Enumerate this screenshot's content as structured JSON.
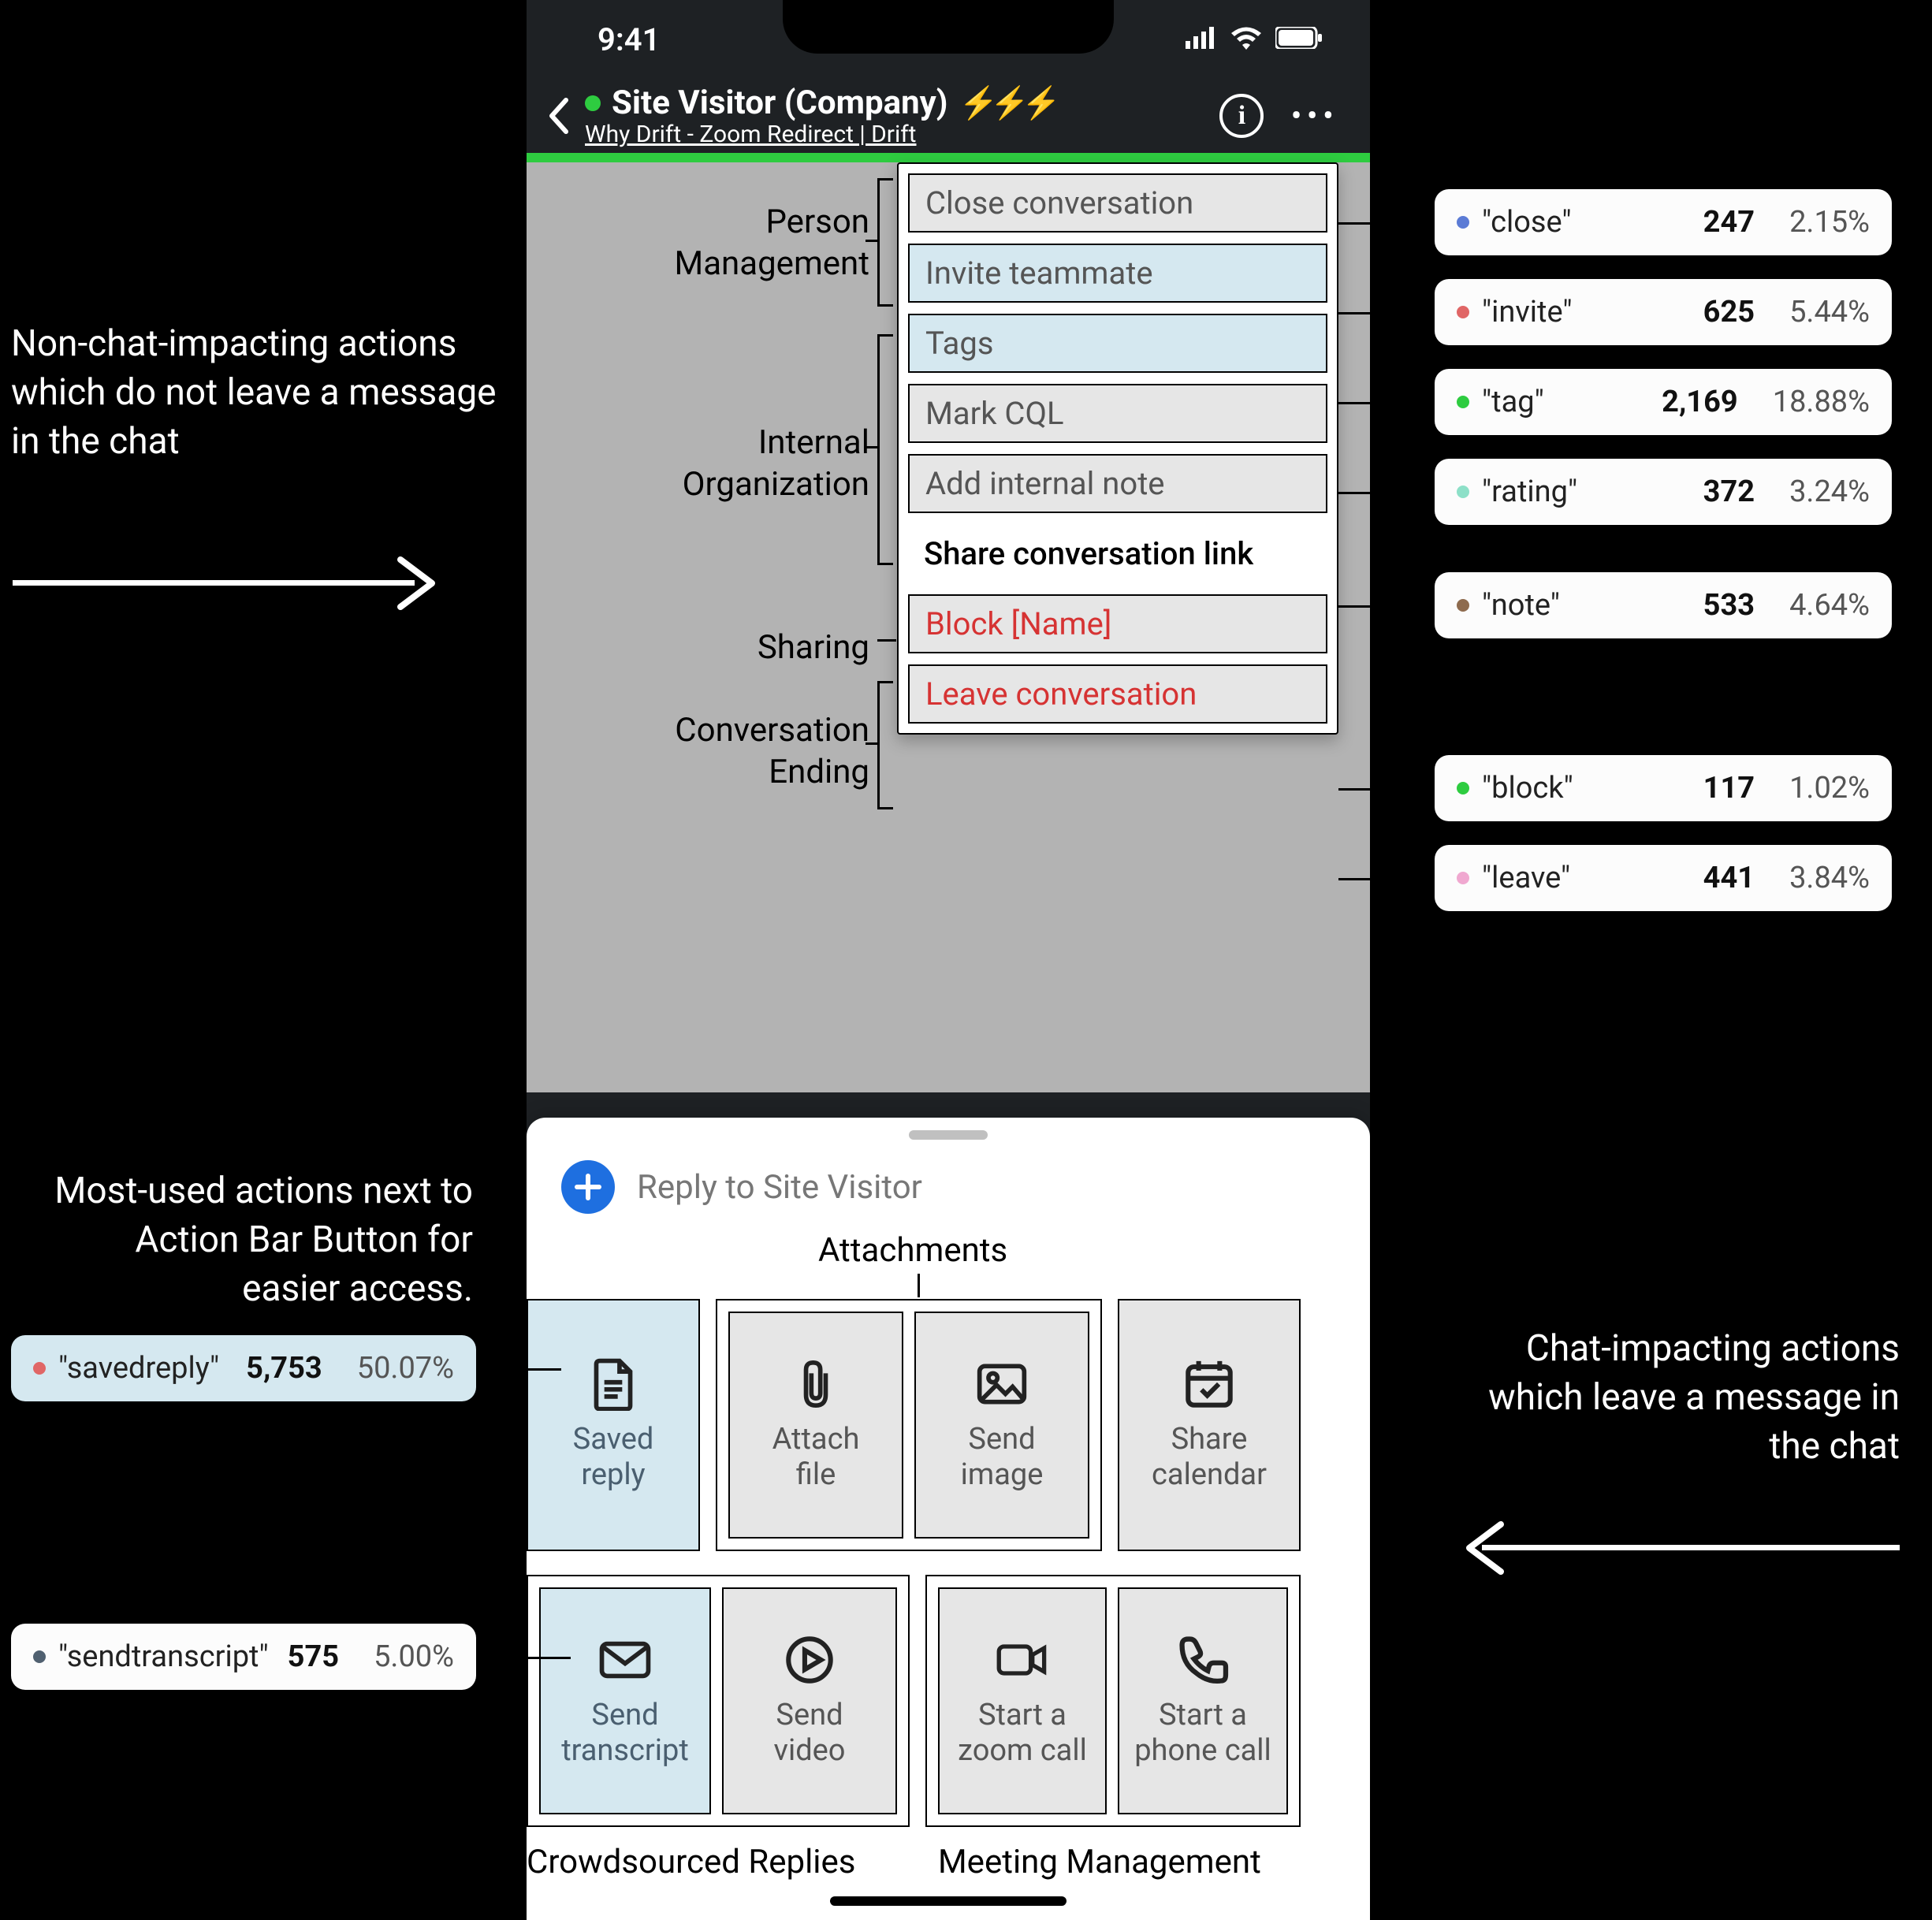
{
  "statusbar": {
    "time": "9:41"
  },
  "header": {
    "title": "Site Visitor (Company)",
    "subtitle": "Why Drift - Zoom Redirect | Drift"
  },
  "categories": {
    "person": "Person\nManagement",
    "internal": "Internal\nOrganization",
    "sharing": "Sharing",
    "ending": "Conversation\nEnding"
  },
  "dropdown": {
    "close": "Close conversation",
    "invite": "Invite teammate",
    "tags": "Tags",
    "markcql": "Mark CQL",
    "addnote": "Add internal note",
    "share": "Share conversation link",
    "block": "Block [Name]",
    "leave": "Leave conversation"
  },
  "reply": {
    "placeholder": "Reply to Site Visitor"
  },
  "tiles": {
    "savedreply": "Saved\nreply",
    "attachfile": "Attach\nfile",
    "sendimage": "Send\nimage",
    "calendar": "Share\ncalendar",
    "transcript": "Send\ntranscript",
    "video": "Send\nvideo",
    "zoom": "Start a\nzoom call",
    "phone": "Start a\nphone call"
  },
  "subcaps": {
    "attachments": "Attachments",
    "crowd": "Crowdsourced Replies",
    "meeting": "Meeting Management"
  },
  "stats": {
    "close": {
      "name": "\"close\"",
      "num": "247",
      "pct": "2.15%",
      "color": "#5b7bd5"
    },
    "invite": {
      "name": "\"invite\"",
      "num": "625",
      "pct": "5.44%",
      "color": "#e06666"
    },
    "tag": {
      "name": "\"tag\"",
      "num": "2,169",
      "pct": "18.88%",
      "color": "#2ecc40"
    },
    "rating": {
      "name": "\"rating\"",
      "num": "372",
      "pct": "3.24%",
      "color": "#8de0c8"
    },
    "note": {
      "name": "\"note\"",
      "num": "533",
      "pct": "4.64%",
      "color": "#8e6b4e"
    },
    "block": {
      "name": "\"block\"",
      "num": "117",
      "pct": "1.02%",
      "color": "#2ecc40"
    },
    "leave": {
      "name": "\"leave\"",
      "num": "441",
      "pct": "3.84%",
      "color": "#f0a8d0"
    },
    "savedreply": {
      "name": "\"savedreply\"",
      "num": "5,753",
      "pct": "50.07%",
      "color": "#e06666"
    },
    "transcript": {
      "name": "\"sendtranscript\"",
      "num": "575",
      "pct": "5.00%",
      "color": "#506070"
    }
  },
  "anno": {
    "topleft": "Non-chat-impacting actions which do not leave a message in the chat",
    "midleft": "Most-used actions next to Action Bar Button for easier access.",
    "right": "Chat-impacting actions which leave a message in the  chat"
  }
}
